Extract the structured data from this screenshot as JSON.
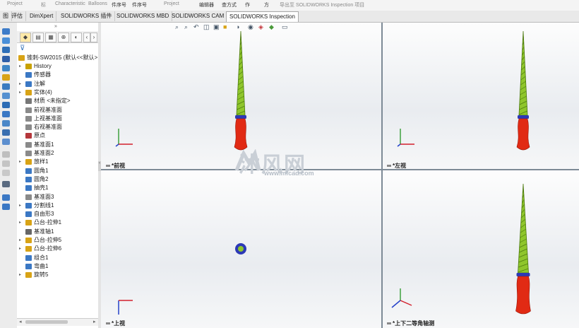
{
  "ribbon": {
    "items": [
      "Project",
      "标",
      "Characteristic",
      "Balloons",
      "件序号",
      "件序号",
      "Project",
      "编辑器",
      "查方式",
      "作",
      "方",
      "导出至 SOLIDWORKS Inspection 项目"
    ]
  },
  "tabs": [
    {
      "label": "图"
    },
    {
      "label": "评估"
    },
    {
      "label": "DimXpert"
    },
    {
      "label": "SOLIDWORKS 插件"
    },
    {
      "label": "SOLIDWORKS MBD"
    },
    {
      "label": "SOLIDWORKS CAM"
    },
    {
      "label": "SOLIDWORKS Inspection",
      "active": true
    }
  ],
  "tree": {
    "root": "锥刺-SW2015 (默认<<默认>",
    "items": [
      {
        "label": "History",
        "expandable": true,
        "icon": "history-icon",
        "color": "#c9a200"
      },
      {
        "label": "传感器",
        "expandable": false,
        "icon": "sensor-icon",
        "color": "#3b78c4"
      },
      {
        "label": "注解",
        "expandable": true,
        "icon": "annotation-icon",
        "color": "#3b78c4"
      },
      {
        "label": "实体(4)",
        "expandable": true,
        "icon": "solid-body-icon",
        "color": "#d8a316"
      },
      {
        "label": "材质 <未指定>",
        "expandable": false,
        "icon": "material-icon",
        "color": "#777777"
      },
      {
        "label": "前视基准面",
        "expandable": false,
        "icon": "plane-icon",
        "color": "#8a8a8a"
      },
      {
        "label": "上视基准面",
        "expandable": false,
        "icon": "plane-icon",
        "color": "#8a8a8a"
      },
      {
        "label": "右视基准面",
        "expandable": false,
        "icon": "plane-icon",
        "color": "#8a8a8a"
      },
      {
        "label": "原点",
        "expandable": false,
        "icon": "origin-icon",
        "color": "#b5373c"
      },
      {
        "label": "基准面1",
        "expandable": false,
        "icon": "plane-icon",
        "color": "#8a8a8a"
      },
      {
        "label": "基准面2",
        "expandable": false,
        "icon": "plane-icon",
        "color": "#8a8a8a"
      },
      {
        "label": "放样1",
        "expandable": true,
        "icon": "loft-icon",
        "color": "#d8a316"
      },
      {
        "label": "圆角1",
        "expandable": false,
        "icon": "fillet-icon",
        "color": "#3b78c4"
      },
      {
        "label": "圆角2",
        "expandable": false,
        "icon": "fillet-icon",
        "color": "#3b78c4"
      },
      {
        "label": "抽壳1",
        "expandable": false,
        "icon": "shell-icon",
        "color": "#3b78c4"
      },
      {
        "label": "基准面3",
        "expandable": false,
        "icon": "plane-icon",
        "color": "#8a8a8a"
      },
      {
        "label": "分割线1",
        "expandable": true,
        "icon": "split-line-icon",
        "color": "#3b78c4"
      },
      {
        "label": "自由形3",
        "expandable": false,
        "icon": "freeform-icon",
        "color": "#3b78c4"
      },
      {
        "label": "凸台-拉伸1",
        "expandable": true,
        "icon": "boss-extrude-icon",
        "color": "#d8a316"
      },
      {
        "label": "基准轴1",
        "expandable": false,
        "icon": "axis-icon",
        "color": "#666666"
      },
      {
        "label": "凸台-拉伸5",
        "expandable": true,
        "icon": "boss-extrude-icon",
        "color": "#d8a316"
      },
      {
        "label": "凸台-拉伸6",
        "expandable": true,
        "icon": "boss-extrude-icon",
        "color": "#d8a316"
      },
      {
        "label": "组合1",
        "expandable": false,
        "icon": "combine-icon",
        "color": "#3b78c4"
      },
      {
        "label": "弯曲1",
        "expandable": false,
        "icon": "flex-icon",
        "color": "#3b78c4"
      },
      {
        "label": "旋转5",
        "expandable": true,
        "icon": "revolve-icon",
        "color": "#d8a316"
      }
    ]
  },
  "viewports": [
    {
      "label": "*前视",
      "view": "front"
    },
    {
      "label": "*左视",
      "view": "left"
    },
    {
      "label": "*上视",
      "view": "top"
    },
    {
      "label": "*上下二等角轴测",
      "view": "dimetric"
    }
  ],
  "watermark": {
    "main": "沐风网",
    "sub": "www.mfcad.com"
  },
  "colors": {
    "blade": "#8fc62c",
    "blade_dark": "#4d7a10",
    "handle": "#e12a14",
    "guard": "#2c39b6",
    "axis_x": "#d3212d",
    "axis_y": "#3ea13e",
    "axis_z": "#2441c9",
    "active_tab": "#ffffff"
  }
}
